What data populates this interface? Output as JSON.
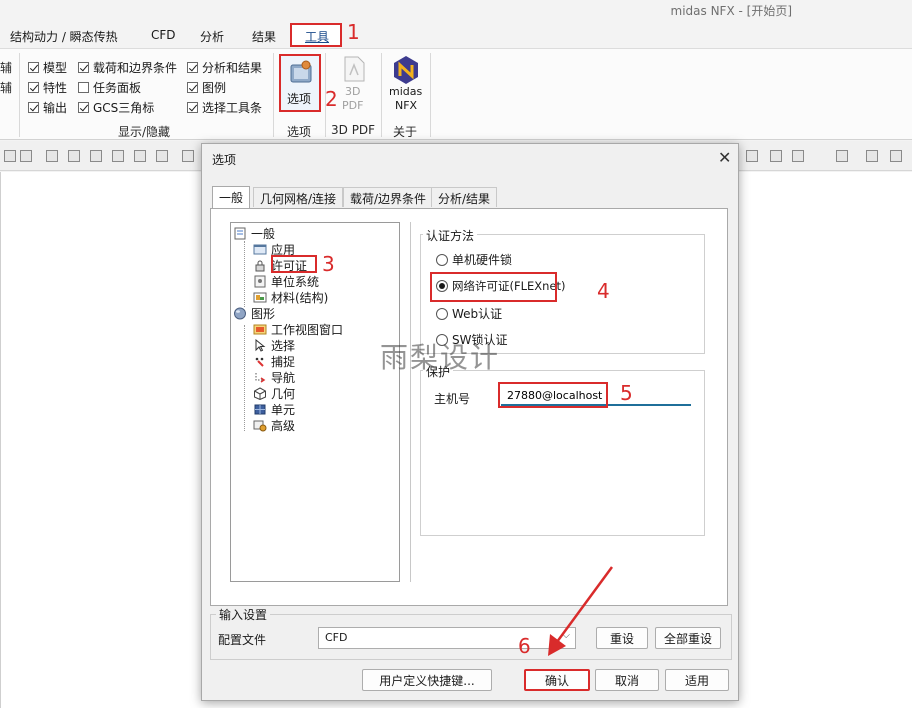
{
  "app": {
    "title": "midas NFX - [开始页]"
  },
  "menu": {
    "tabs": [
      "结构动力 / 瞬态传热",
      "CFD",
      "分析",
      "结果",
      "工具"
    ],
    "active": "工具"
  },
  "ribbon": {
    "left_partial": [
      "辅",
      "辅"
    ],
    "checks": [
      {
        "label": "模型",
        "checked": true
      },
      {
        "label": "特性",
        "checked": true
      },
      {
        "label": "输出",
        "checked": true
      },
      {
        "label": "载荷和边界条件",
        "checked": true
      },
      {
        "label": "任务面板",
        "checked": false
      },
      {
        "label": "GCS三角标",
        "checked": true
      },
      {
        "label": "分析和结果",
        "checked": true
      },
      {
        "label": "图例",
        "checked": true
      },
      {
        "label": "选择工具条",
        "checked": true
      }
    ],
    "group_show_hide": "显示/隐藏",
    "options_button": "选项",
    "group_options": "选项",
    "pdf_button_line1": "3D",
    "pdf_button_line2": "PDF",
    "group_pdf": "3D PDF",
    "about_line1": "midas",
    "about_line2": "NFX",
    "group_about": "关于"
  },
  "annotations": [
    "1",
    "2",
    "3",
    "4",
    "5",
    "6"
  ],
  "dialog": {
    "title": "选项",
    "close": "✕",
    "tabs": [
      "一般",
      "几何网格/连接",
      "载荷/边界条件",
      "分析/结果"
    ],
    "tree": [
      {
        "label": "一般",
        "level": 0,
        "icon": "document-icon"
      },
      {
        "label": "应用",
        "level": 1,
        "icon": "window-icon"
      },
      {
        "label": "许可证",
        "level": 1,
        "icon": "lock-icon"
      },
      {
        "label": "单位系统",
        "level": 1,
        "icon": "units-icon"
      },
      {
        "label": "材料(结构)",
        "level": 1,
        "icon": "material-icon"
      },
      {
        "label": "图形",
        "level": 0,
        "icon": "globe-icon"
      },
      {
        "label": "工作视图窗口",
        "level": 1,
        "icon": "view-window-icon"
      },
      {
        "label": "选择",
        "level": 1,
        "icon": "cursor-icon"
      },
      {
        "label": "捕捉",
        "level": 1,
        "icon": "snap-icon"
      },
      {
        "label": "导航",
        "level": 1,
        "icon": "navigate-icon"
      },
      {
        "label": "几何",
        "level": 1,
        "icon": "cube-icon"
      },
      {
        "label": "单元",
        "level": 1,
        "icon": "element-icon"
      },
      {
        "label": "高级",
        "level": 1,
        "icon": "advanced-icon"
      }
    ],
    "auth": {
      "legend": "认证方法",
      "options": [
        "单机硬件锁",
        "网络许可证(FLEXnet)",
        "Web认证",
        "SW锁认证"
      ],
      "selected": "网络许可证(FLEXnet)"
    },
    "protect": {
      "legend": "保护",
      "host_label": "主机号",
      "host_value": "27880@localhost"
    },
    "input_settings": {
      "legend": "输入设置",
      "config_label": "配置文件",
      "config_value": "CFD",
      "reset": "重设",
      "reset_all": "全部重设"
    },
    "buttons": {
      "shortcuts": "用户定义快捷键...",
      "ok": "确认",
      "cancel": "取消",
      "apply": "适用"
    }
  },
  "watermark": "雨梨设计",
  "colors": {
    "annotation_red": "#d92b2b",
    "input_underline": "#1f6f9a"
  }
}
